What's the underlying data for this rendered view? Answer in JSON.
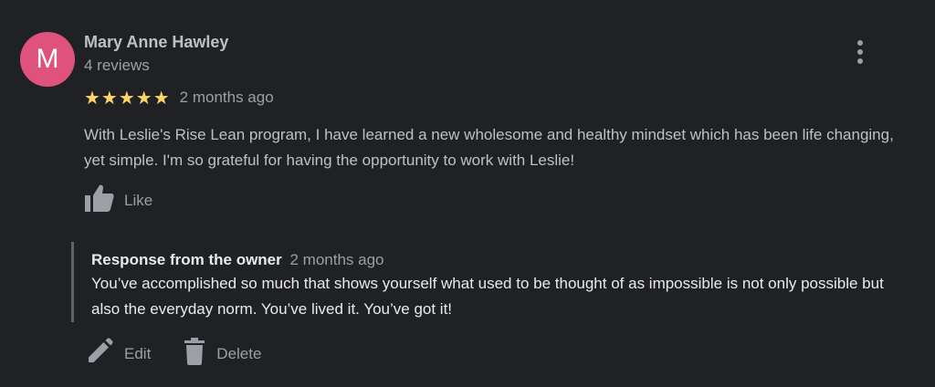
{
  "reviewer": {
    "initial": "M",
    "avatar_color": "#e0527e",
    "name": "Mary Anne Hawley",
    "review_count": "4 reviews"
  },
  "review": {
    "stars": "★★★★★",
    "rating": 5,
    "date": "2 months ago",
    "text": "With Leslie's Rise Lean program, I have learned a new wholesome and healthy mindset which has been life changing, yet simple. I'm so grateful for having the opportunity to work with Leslie!",
    "like_label": "Like",
    "star_color": "#fdd663"
  },
  "owner_response": {
    "title": "Response from the owner",
    "date": "2 months ago",
    "text": "You’ve accomplished so much that shows yourself what used to be thought of as impossible is not only possible but also the everyday norm. You’ve lived it. You’ve got it!"
  },
  "actions": {
    "edit_label": "Edit",
    "delete_label": "Delete"
  },
  "icons": {
    "more": "more-vert-icon",
    "like": "thumbs-up-icon",
    "edit": "pencil-icon",
    "delete": "trash-icon"
  }
}
